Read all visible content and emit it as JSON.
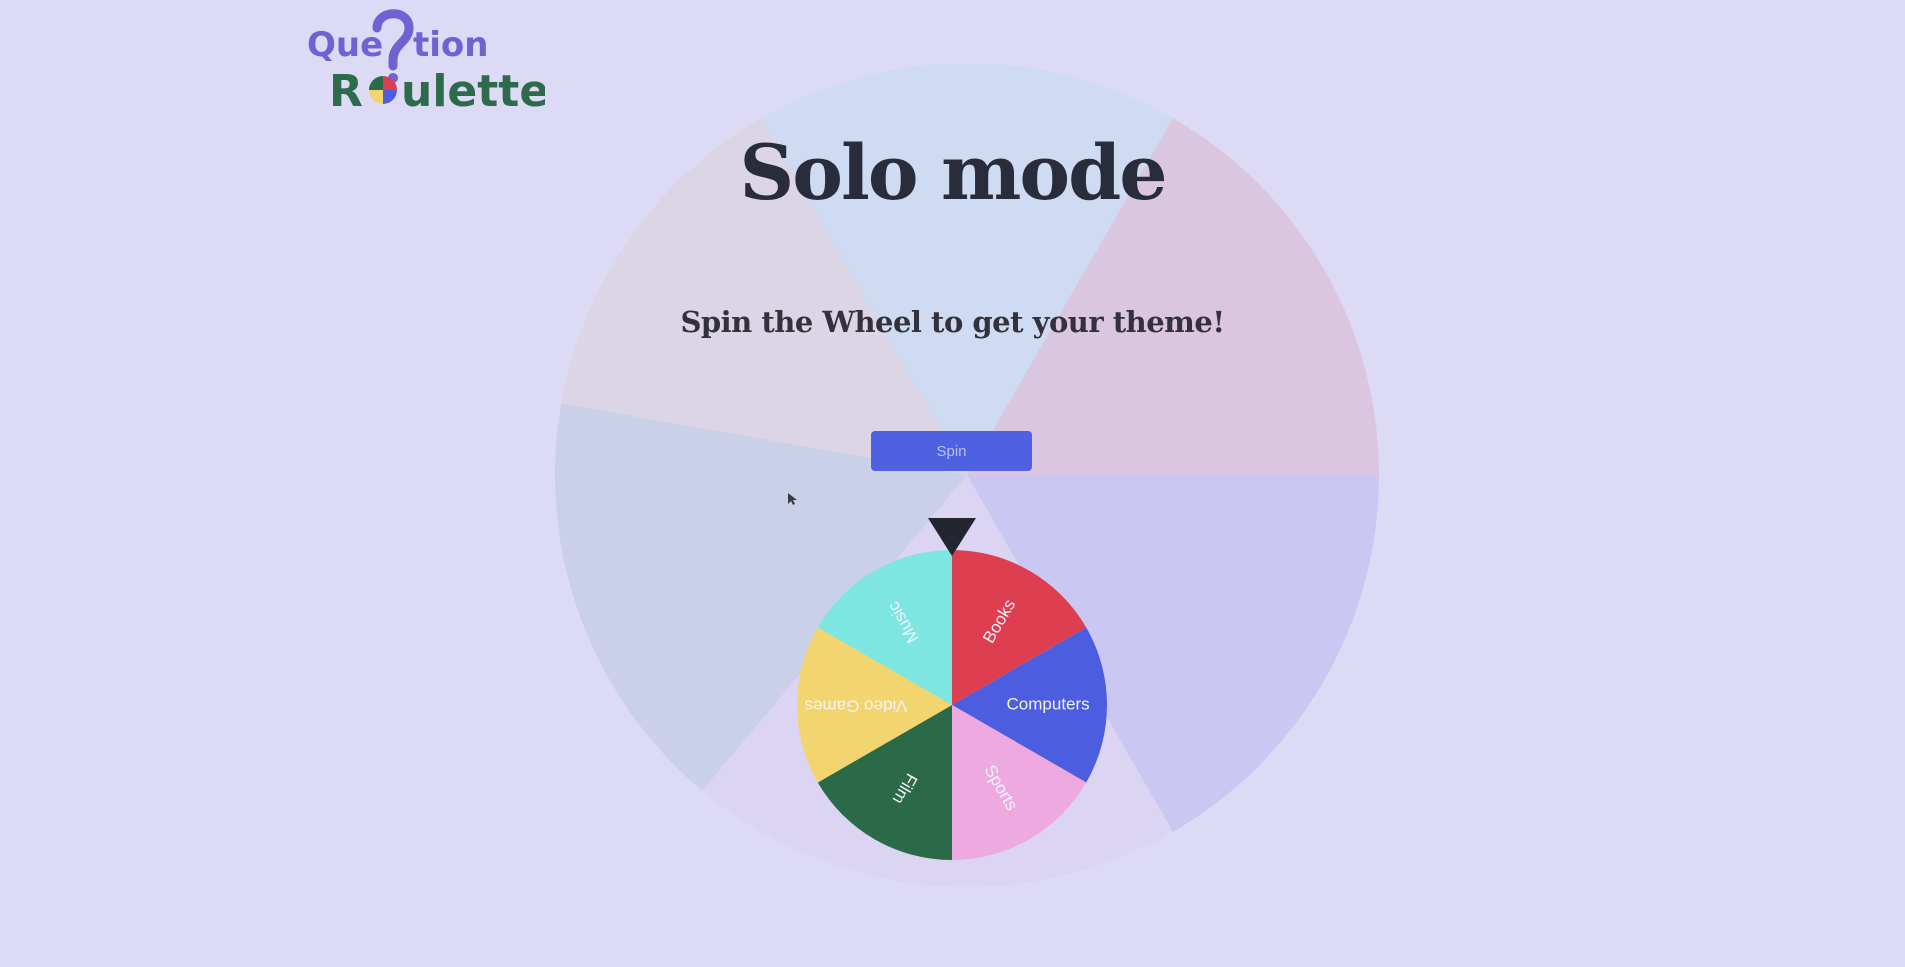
{
  "logo": {
    "line1": [
      "Que",
      "tion"
    ],
    "line2": [
      "R",
      "ulette"
    ],
    "colors": {
      "question": "#6f63d4",
      "roulette": "#2e6b4c"
    }
  },
  "page": {
    "title": "Solo mode",
    "subtitle": "Spin the Wheel to get your theme!",
    "spin_label": "Spin"
  },
  "wheel": {
    "pointer_color": "#23262f",
    "segments": [
      {
        "label": "Books",
        "color": "#de3f50"
      },
      {
        "label": "Computers",
        "color": "#4c5de0"
      },
      {
        "label": "Sports",
        "color": "#eeaae0"
      },
      {
        "label": "Film",
        "color": "#2a6a48"
      },
      {
        "label": "Video Games",
        "color": "#f2d56e"
      },
      {
        "label": "Music",
        "color": "#7ee6e1"
      }
    ]
  },
  "background_wheel_colors": [
    "#dbd3e3",
    "#cbdaf2",
    "#dbc2de",
    "#c7c4f1",
    "#dbd3f2",
    "#c5cee5"
  ]
}
